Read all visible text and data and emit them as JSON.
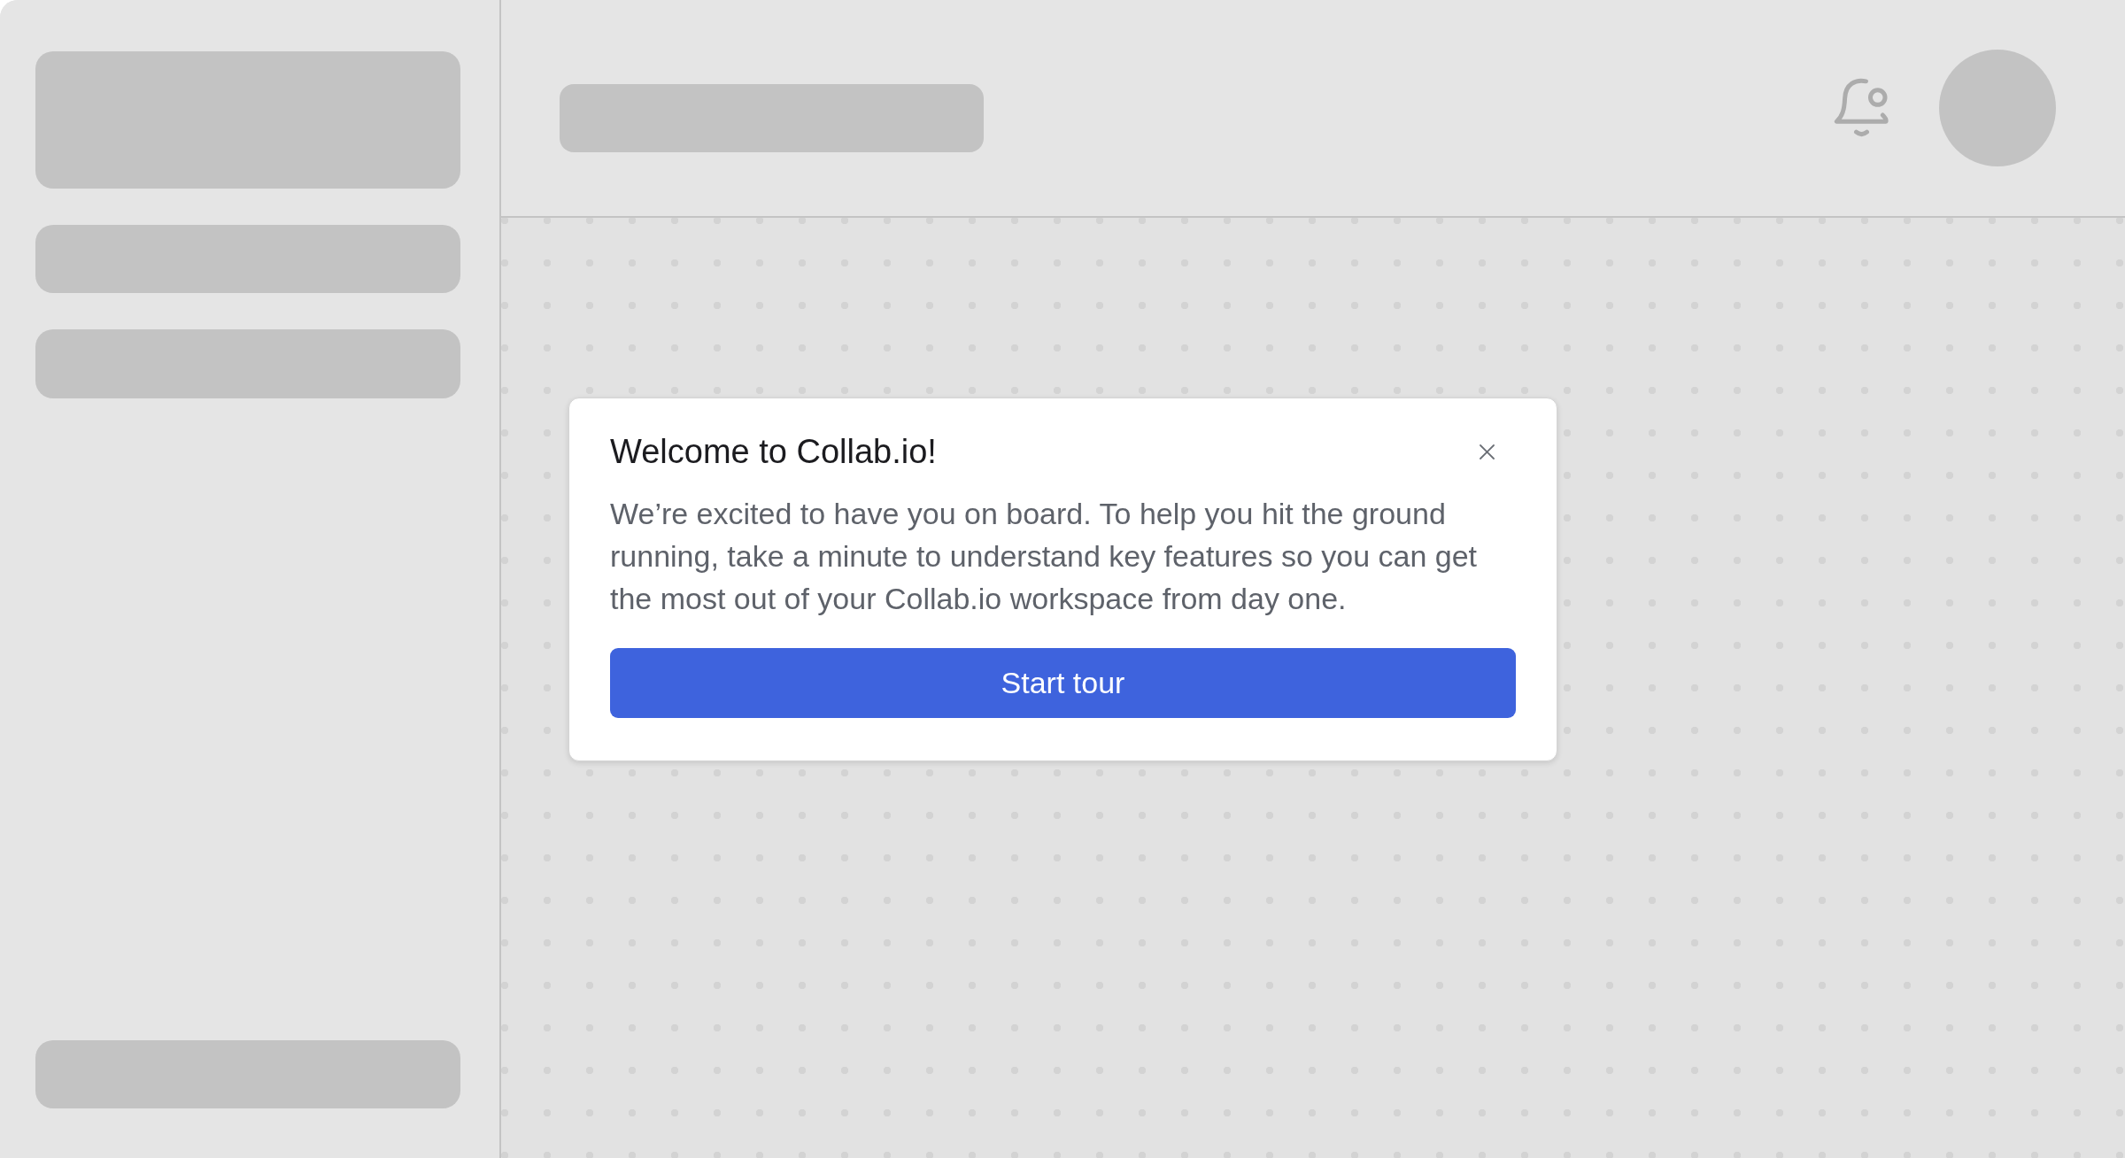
{
  "dialog": {
    "title": "Welcome to Collab.io!",
    "body": "We’re excited to have you on board. To help you hit the ground running, take a minute to understand key features so you can get the most out of your Collab.io workspace from day one.",
    "button": "Start tour"
  }
}
